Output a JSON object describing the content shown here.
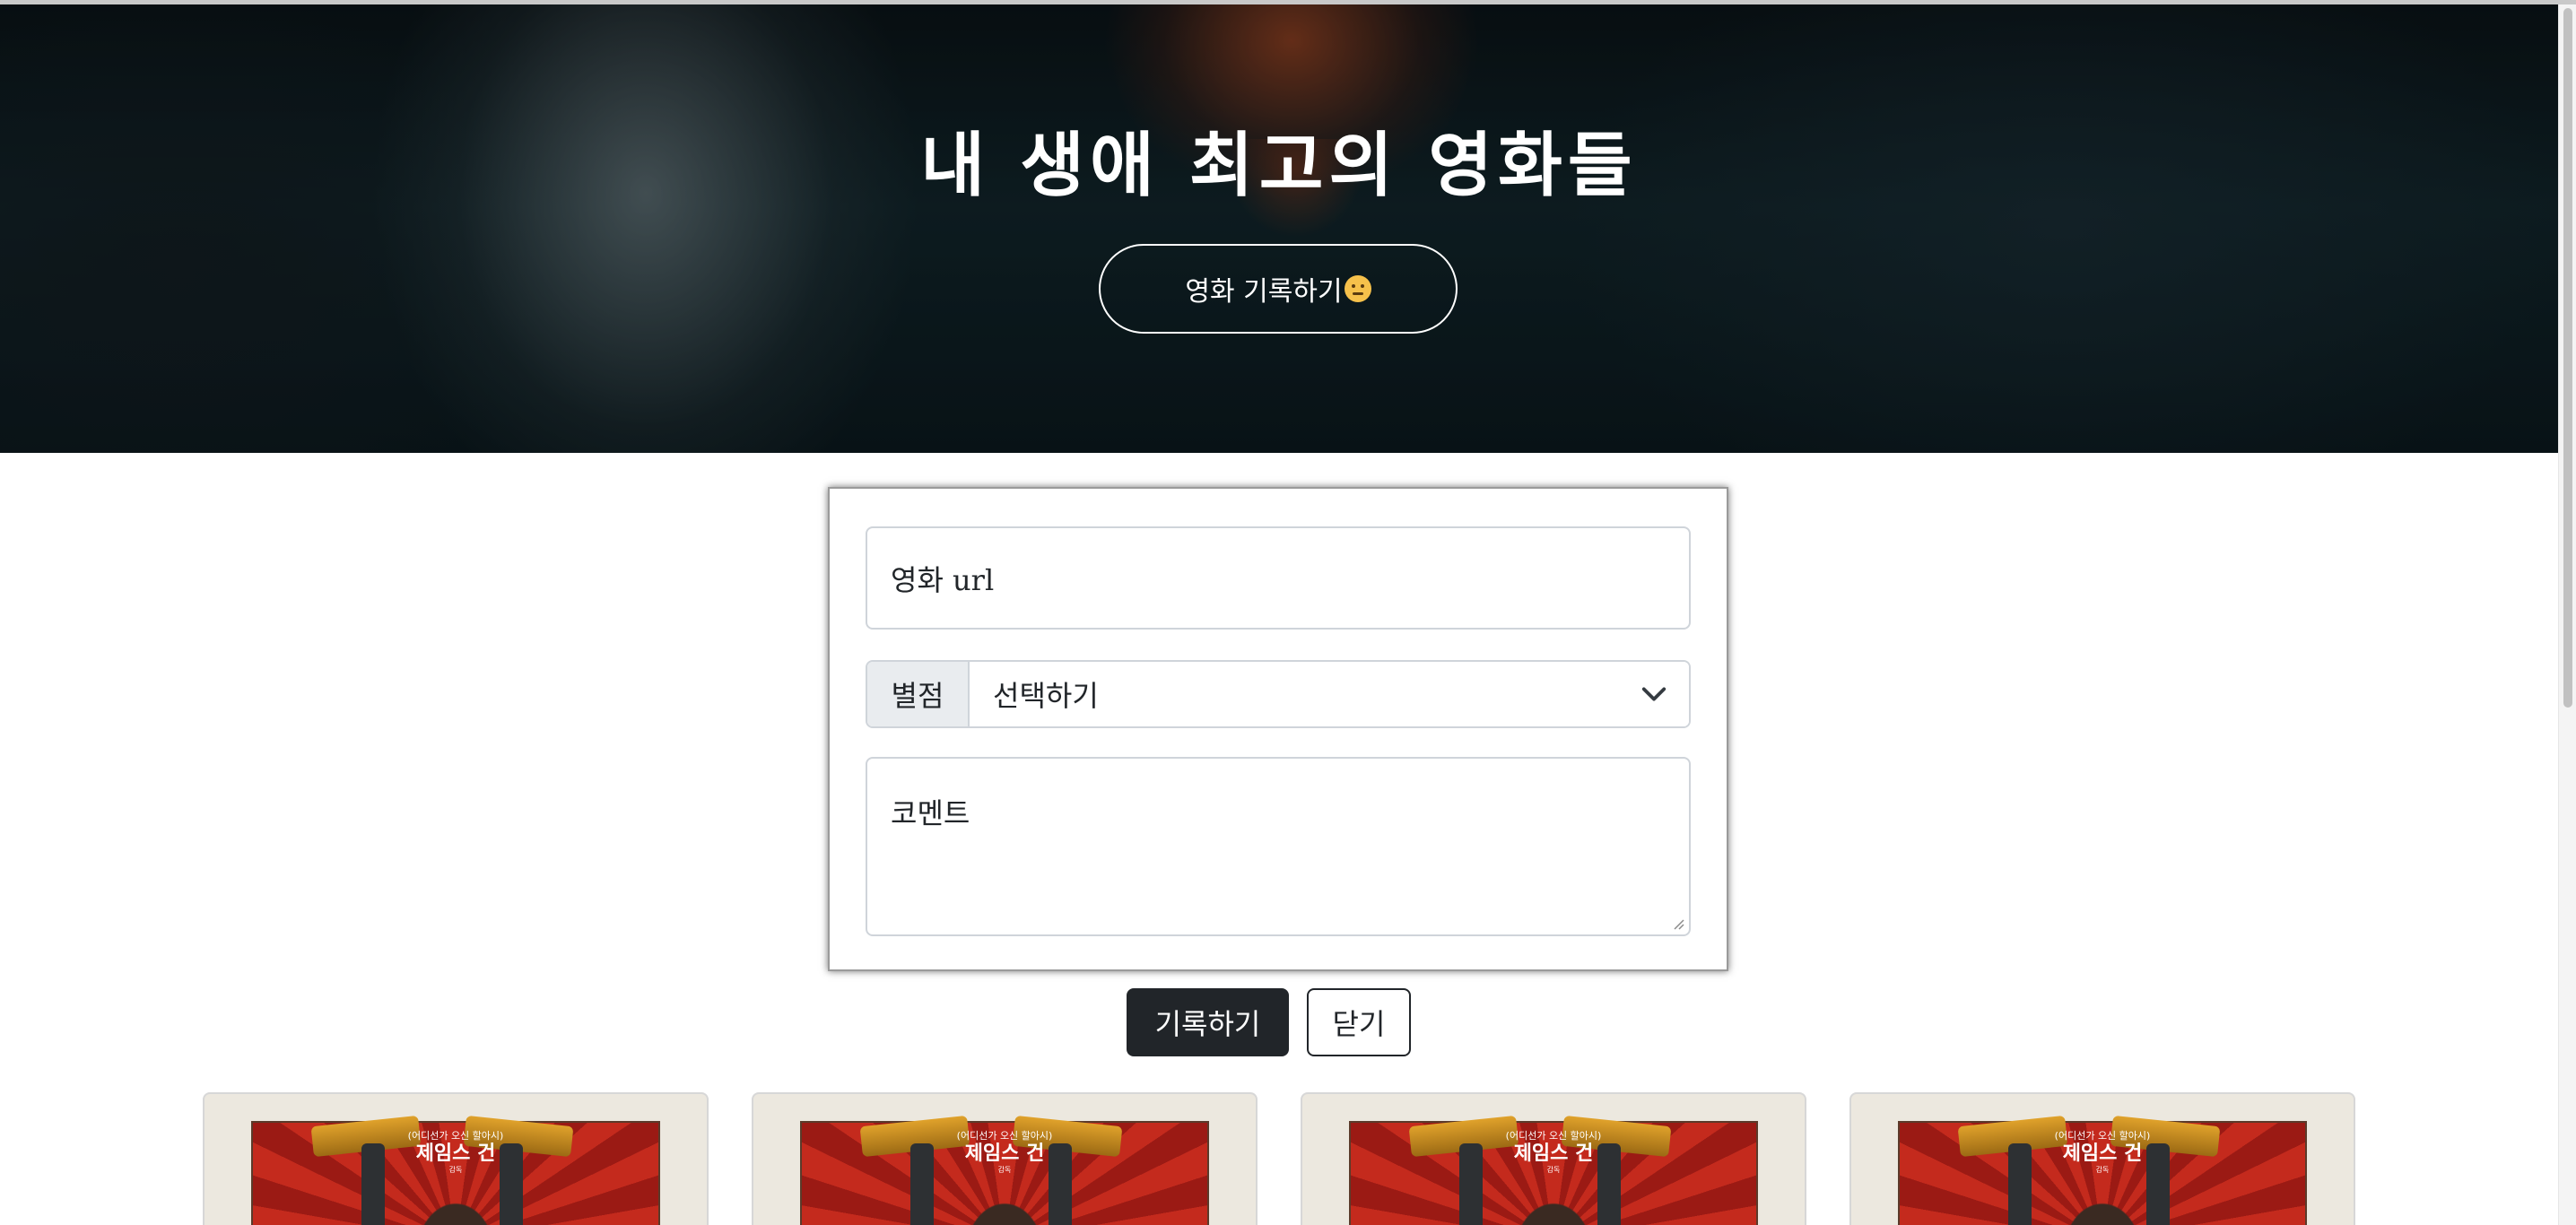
{
  "hero": {
    "title": "내 생애 최고의 영화들",
    "record_button_label": "영화 기록하기",
    "record_button_icon": "thinking-face-emoji-icon"
  },
  "form": {
    "url_placeholder": "영화 url",
    "rating_label": "별점",
    "rating_selected": "선택하기",
    "comment_placeholder": "코멘트"
  },
  "actions": {
    "submit_label": "기록하기",
    "close_label": "닫기"
  },
  "cards": [
    {
      "poster_tagline": "(어디선가 오신 할아시)",
      "poster_title": "제임스 건",
      "poster_credit": "감독"
    },
    {
      "poster_tagline": "(어디선가 오신 할아시)",
      "poster_title": "제임스 건",
      "poster_credit": "감독"
    },
    {
      "poster_tagline": "(어디선가 오신 할아시)",
      "poster_title": "제임스 건",
      "poster_credit": "감독"
    },
    {
      "poster_tagline": "(어디선가 오신 할아시)",
      "poster_title": "제임스 건",
      "poster_credit": "감독"
    }
  ],
  "colors": {
    "button_dark": "#212529",
    "border": "#cfd4da",
    "input_group_bg": "#e9ecef"
  }
}
